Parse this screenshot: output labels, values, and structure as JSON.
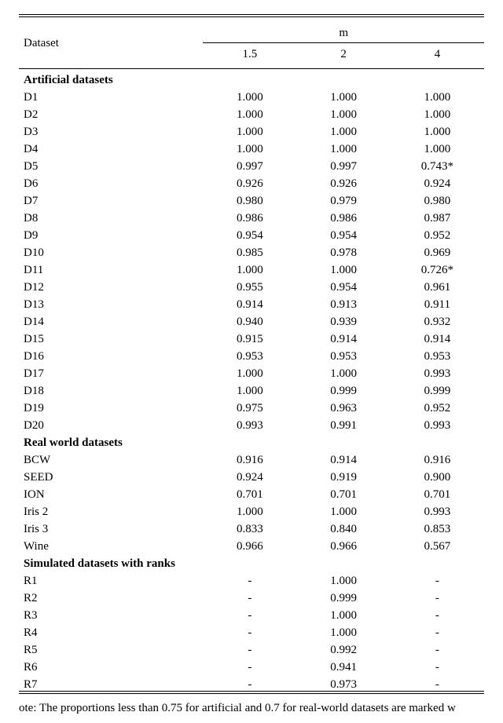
{
  "header": {
    "dataset_label": "Dataset",
    "m_label": "m",
    "columns": [
      "1.5",
      "2",
      "4"
    ]
  },
  "sections": [
    {
      "title": "Artificial datasets",
      "rows": [
        {
          "label": "D1",
          "vals": [
            "1.000",
            "1.000",
            "1.000"
          ]
        },
        {
          "label": "D2",
          "vals": [
            "1.000",
            "1.000",
            "1.000"
          ]
        },
        {
          "label": "D3",
          "vals": [
            "1.000",
            "1.000",
            "1.000"
          ]
        },
        {
          "label": "D4",
          "vals": [
            "1.000",
            "1.000",
            "1.000"
          ]
        },
        {
          "label": "D5",
          "vals": [
            "0.997",
            "0.997",
            "0.743*"
          ]
        },
        {
          "label": "D6",
          "vals": [
            "0.926",
            "0.926",
            "0.924"
          ]
        },
        {
          "label": "D7",
          "vals": [
            "0.980",
            "0.979",
            "0.980"
          ]
        },
        {
          "label": "D8",
          "vals": [
            "0.986",
            "0.986",
            "0.987"
          ]
        },
        {
          "label": "D9",
          "vals": [
            "0.954",
            "0.954",
            "0.952"
          ]
        },
        {
          "label": "D10",
          "vals": [
            "0.985",
            "0.978",
            "0.969"
          ]
        },
        {
          "label": "D11",
          "vals": [
            "1.000",
            "1.000",
            "0.726*"
          ]
        },
        {
          "label": "D12",
          "vals": [
            "0.955",
            "0.954",
            "0.961"
          ]
        },
        {
          "label": "D13",
          "vals": [
            "0.914",
            "0.913",
            "0.911"
          ]
        },
        {
          "label": "D14",
          "vals": [
            "0.940",
            "0.939",
            "0.932"
          ]
        },
        {
          "label": "D15",
          "vals": [
            "0.915",
            "0.914",
            "0.914"
          ]
        },
        {
          "label": "D16",
          "vals": [
            "0.953",
            "0.953",
            "0.953"
          ]
        },
        {
          "label": "D17",
          "vals": [
            "1.000",
            "1.000",
            "0.993"
          ]
        },
        {
          "label": "D18",
          "vals": [
            "1.000",
            "0.999",
            "0.999"
          ]
        },
        {
          "label": "D19",
          "vals": [
            "0.975",
            "0.963",
            "0.952"
          ]
        },
        {
          "label": "D20",
          "vals": [
            "0.993",
            "0.991",
            "0.993"
          ]
        }
      ]
    },
    {
      "title": "Real world datasets",
      "rows": [
        {
          "label": "BCW",
          "vals": [
            "0.916",
            "0.914",
            "0.916"
          ]
        },
        {
          "label": "SEED",
          "vals": [
            "0.924",
            "0.919",
            "0.900"
          ]
        },
        {
          "label": "ION",
          "vals": [
            "0.701",
            "0.701",
            "0.701"
          ]
        },
        {
          "label": "Iris 2",
          "vals": [
            "1.000",
            "1.000",
            "0.993"
          ]
        },
        {
          "label": "Iris 3",
          "vals": [
            "0.833",
            "0.840",
            "0.853"
          ]
        },
        {
          "label": "Wine",
          "vals": [
            "0.966",
            "0.966",
            "0.567"
          ]
        }
      ]
    },
    {
      "title": "Simulated datasets with ranks",
      "rows": [
        {
          "label": "R1",
          "vals": [
            "-",
            "1.000",
            "-"
          ]
        },
        {
          "label": "R2",
          "vals": [
            "-",
            "0.999",
            "-"
          ]
        },
        {
          "label": "R3",
          "vals": [
            "-",
            "1.000",
            "-"
          ]
        },
        {
          "label": "R4",
          "vals": [
            "-",
            "1.000",
            "-"
          ]
        },
        {
          "label": "R5",
          "vals": [
            "-",
            "0.992",
            "-"
          ]
        },
        {
          "label": "R6",
          "vals": [
            "-",
            "0.941",
            "-"
          ]
        },
        {
          "label": "R7",
          "vals": [
            "-",
            "0.973",
            "-"
          ]
        }
      ]
    }
  ],
  "note": "ote: The proportions less than 0.75 for artificial and 0.7 for real-world datasets are marked w",
  "chart_data": {
    "type": "table",
    "title": "",
    "columns": [
      "Dataset",
      "m=1.5",
      "m=2",
      "m=4"
    ],
    "series": [
      {
        "name": "Artificial datasets",
        "values": [
          [
            "D1",
            1.0,
            1.0,
            1.0
          ],
          [
            "D2",
            1.0,
            1.0,
            1.0
          ],
          [
            "D3",
            1.0,
            1.0,
            1.0
          ],
          [
            "D4",
            1.0,
            1.0,
            1.0
          ],
          [
            "D5",
            0.997,
            0.997,
            0.743
          ],
          [
            "D6",
            0.926,
            0.926,
            0.924
          ],
          [
            "D7",
            0.98,
            0.979,
            0.98
          ],
          [
            "D8",
            0.986,
            0.986,
            0.987
          ],
          [
            "D9",
            0.954,
            0.954,
            0.952
          ],
          [
            "D10",
            0.985,
            0.978,
            0.969
          ],
          [
            "D11",
            1.0,
            1.0,
            0.726
          ],
          [
            "D12",
            0.955,
            0.954,
            0.961
          ],
          [
            "D13",
            0.914,
            0.913,
            0.911
          ],
          [
            "D14",
            0.94,
            0.939,
            0.932
          ],
          [
            "D15",
            0.915,
            0.914,
            0.914
          ],
          [
            "D16",
            0.953,
            0.953,
            0.953
          ],
          [
            "D17",
            1.0,
            1.0,
            0.993
          ],
          [
            "D18",
            1.0,
            0.999,
            0.999
          ],
          [
            "D19",
            0.975,
            0.963,
            0.952
          ],
          [
            "D20",
            0.993,
            0.991,
            0.993
          ]
        ]
      },
      {
        "name": "Real world datasets",
        "values": [
          [
            "BCW",
            0.916,
            0.914,
            0.916
          ],
          [
            "SEED",
            0.924,
            0.919,
            0.9
          ],
          [
            "ION",
            0.701,
            0.701,
            0.701
          ],
          [
            "Iris 2",
            1.0,
            1.0,
            0.993
          ],
          [
            "Iris 3",
            0.833,
            0.84,
            0.853
          ],
          [
            "Wine",
            0.966,
            0.966,
            0.567
          ]
        ]
      },
      {
        "name": "Simulated datasets with ranks",
        "values": [
          [
            "R1",
            null,
            1.0,
            null
          ],
          [
            "R2",
            null,
            0.999,
            null
          ],
          [
            "R3",
            null,
            1.0,
            null
          ],
          [
            "R4",
            null,
            1.0,
            null
          ],
          [
            "R5",
            null,
            0.992,
            null
          ],
          [
            "R6",
            null,
            0.941,
            null
          ],
          [
            "R7",
            null,
            0.973,
            null
          ]
        ]
      }
    ]
  }
}
